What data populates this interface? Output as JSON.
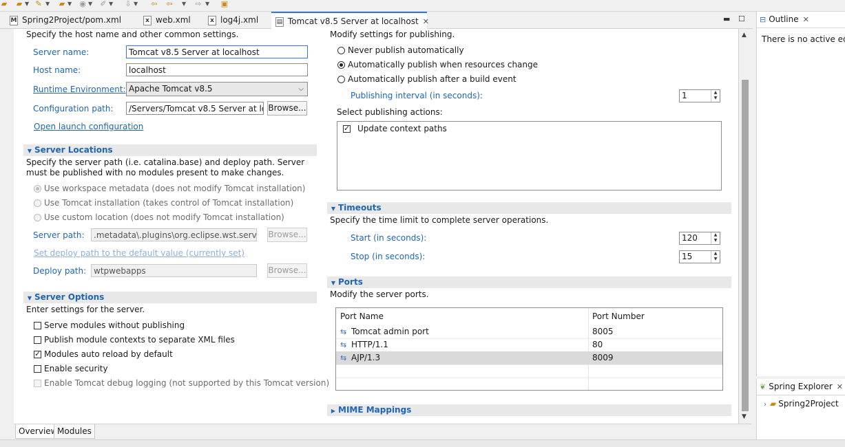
{
  "tabs": [
    {
      "label": "Spring2Project/pom.xml",
      "icon": "maven-pom-file-icon"
    },
    {
      "label": "web.xml",
      "icon": "xml-file-icon"
    },
    {
      "label": "log4j.xml",
      "icon": "xml-file-icon"
    },
    {
      "label": "Tomcat v8.5 Server at localhost",
      "icon": "server-icon",
      "active": true
    }
  ],
  "general": {
    "description": "Specify the host name and other common settings.",
    "server_name_label": "Server name:",
    "server_name_value": "Tomcat v8.5 Server at localhost",
    "host_name_label": "Host name:",
    "host_name_value": "localhost",
    "runtime_label": "Runtime Environment:",
    "runtime_value": "Apache Tomcat v8.5",
    "config_path_label": "Configuration path:",
    "config_path_value": "/Servers/Tomcat v8.5 Server at local",
    "browse_label": "Browse...",
    "open_launch_label": "Open launch configuration"
  },
  "server_locations": {
    "title": "Server Locations",
    "description": "Specify the server path (i.e. catalina.base) and deploy path. Server must be published with no modules present to make changes.",
    "options": [
      "Use workspace metadata (does not modify Tomcat installation)",
      "Use Tomcat installation (takes control of Tomcat installation)",
      "Use custom location (does not modify Tomcat installation)"
    ],
    "server_path_label": "Server path:",
    "server_path_value": ".metadata\\.plugins\\org.eclipse.wst.server.c",
    "browse_label": "Browse...",
    "set_default_label": "Set deploy path to the default value (currently set)",
    "deploy_path_label": "Deploy path:",
    "deploy_path_value": "wtpwebapps"
  },
  "server_options": {
    "title": "Server Options",
    "description": "Enter settings for the server.",
    "options": [
      {
        "label": "Serve modules without publishing",
        "checked": false,
        "enabled": true
      },
      {
        "label": "Publish module contexts to separate XML files",
        "checked": false,
        "enabled": true
      },
      {
        "label": "Modules auto reload by default",
        "checked": true,
        "enabled": true
      },
      {
        "label": "Enable security",
        "checked": false,
        "enabled": true
      },
      {
        "label": "Enable Tomcat debug logging (not supported by this Tomcat version)",
        "checked": false,
        "enabled": false
      }
    ]
  },
  "publishing": {
    "description": "Modify settings for publishing.",
    "options": [
      {
        "label": "Never publish automatically",
        "selected": false
      },
      {
        "label": "Automatically publish when resources change",
        "selected": true
      },
      {
        "label": "Automatically publish after a build event",
        "selected": false
      }
    ],
    "interval_label": "Publishing interval (in seconds):",
    "interval_value": "1",
    "actions_label": "Select publishing actions:",
    "actions": [
      {
        "label": "Update context paths",
        "checked": true
      }
    ]
  },
  "timeouts": {
    "title": "Timeouts",
    "description": "Specify the time limit to complete server operations.",
    "start_label": "Start (in seconds):",
    "start_value": "120",
    "stop_label": "Stop (in seconds):",
    "stop_value": "15"
  },
  "ports": {
    "title": "Ports",
    "description": "Modify the server ports.",
    "columns": [
      "Port Name",
      "Port Number"
    ],
    "rows": [
      {
        "name": "Tomcat admin port",
        "number": "8005"
      },
      {
        "name": "HTTP/1.1",
        "number": "80"
      },
      {
        "name": "AJP/1.3",
        "number": "8009",
        "selected": true
      }
    ]
  },
  "mime": {
    "title": "MIME Mappings"
  },
  "bottom_tabs": [
    "Overview",
    "Modules"
  ],
  "outline": {
    "title": "Outline",
    "message": "There is no active edito"
  },
  "spring_explorer": {
    "title": "Spring Explorer",
    "items": [
      "Spring2Project"
    ]
  },
  "colors": {
    "link": "#2066b3",
    "section_bg": "#e8e8e8",
    "accent": "#3875d7"
  }
}
